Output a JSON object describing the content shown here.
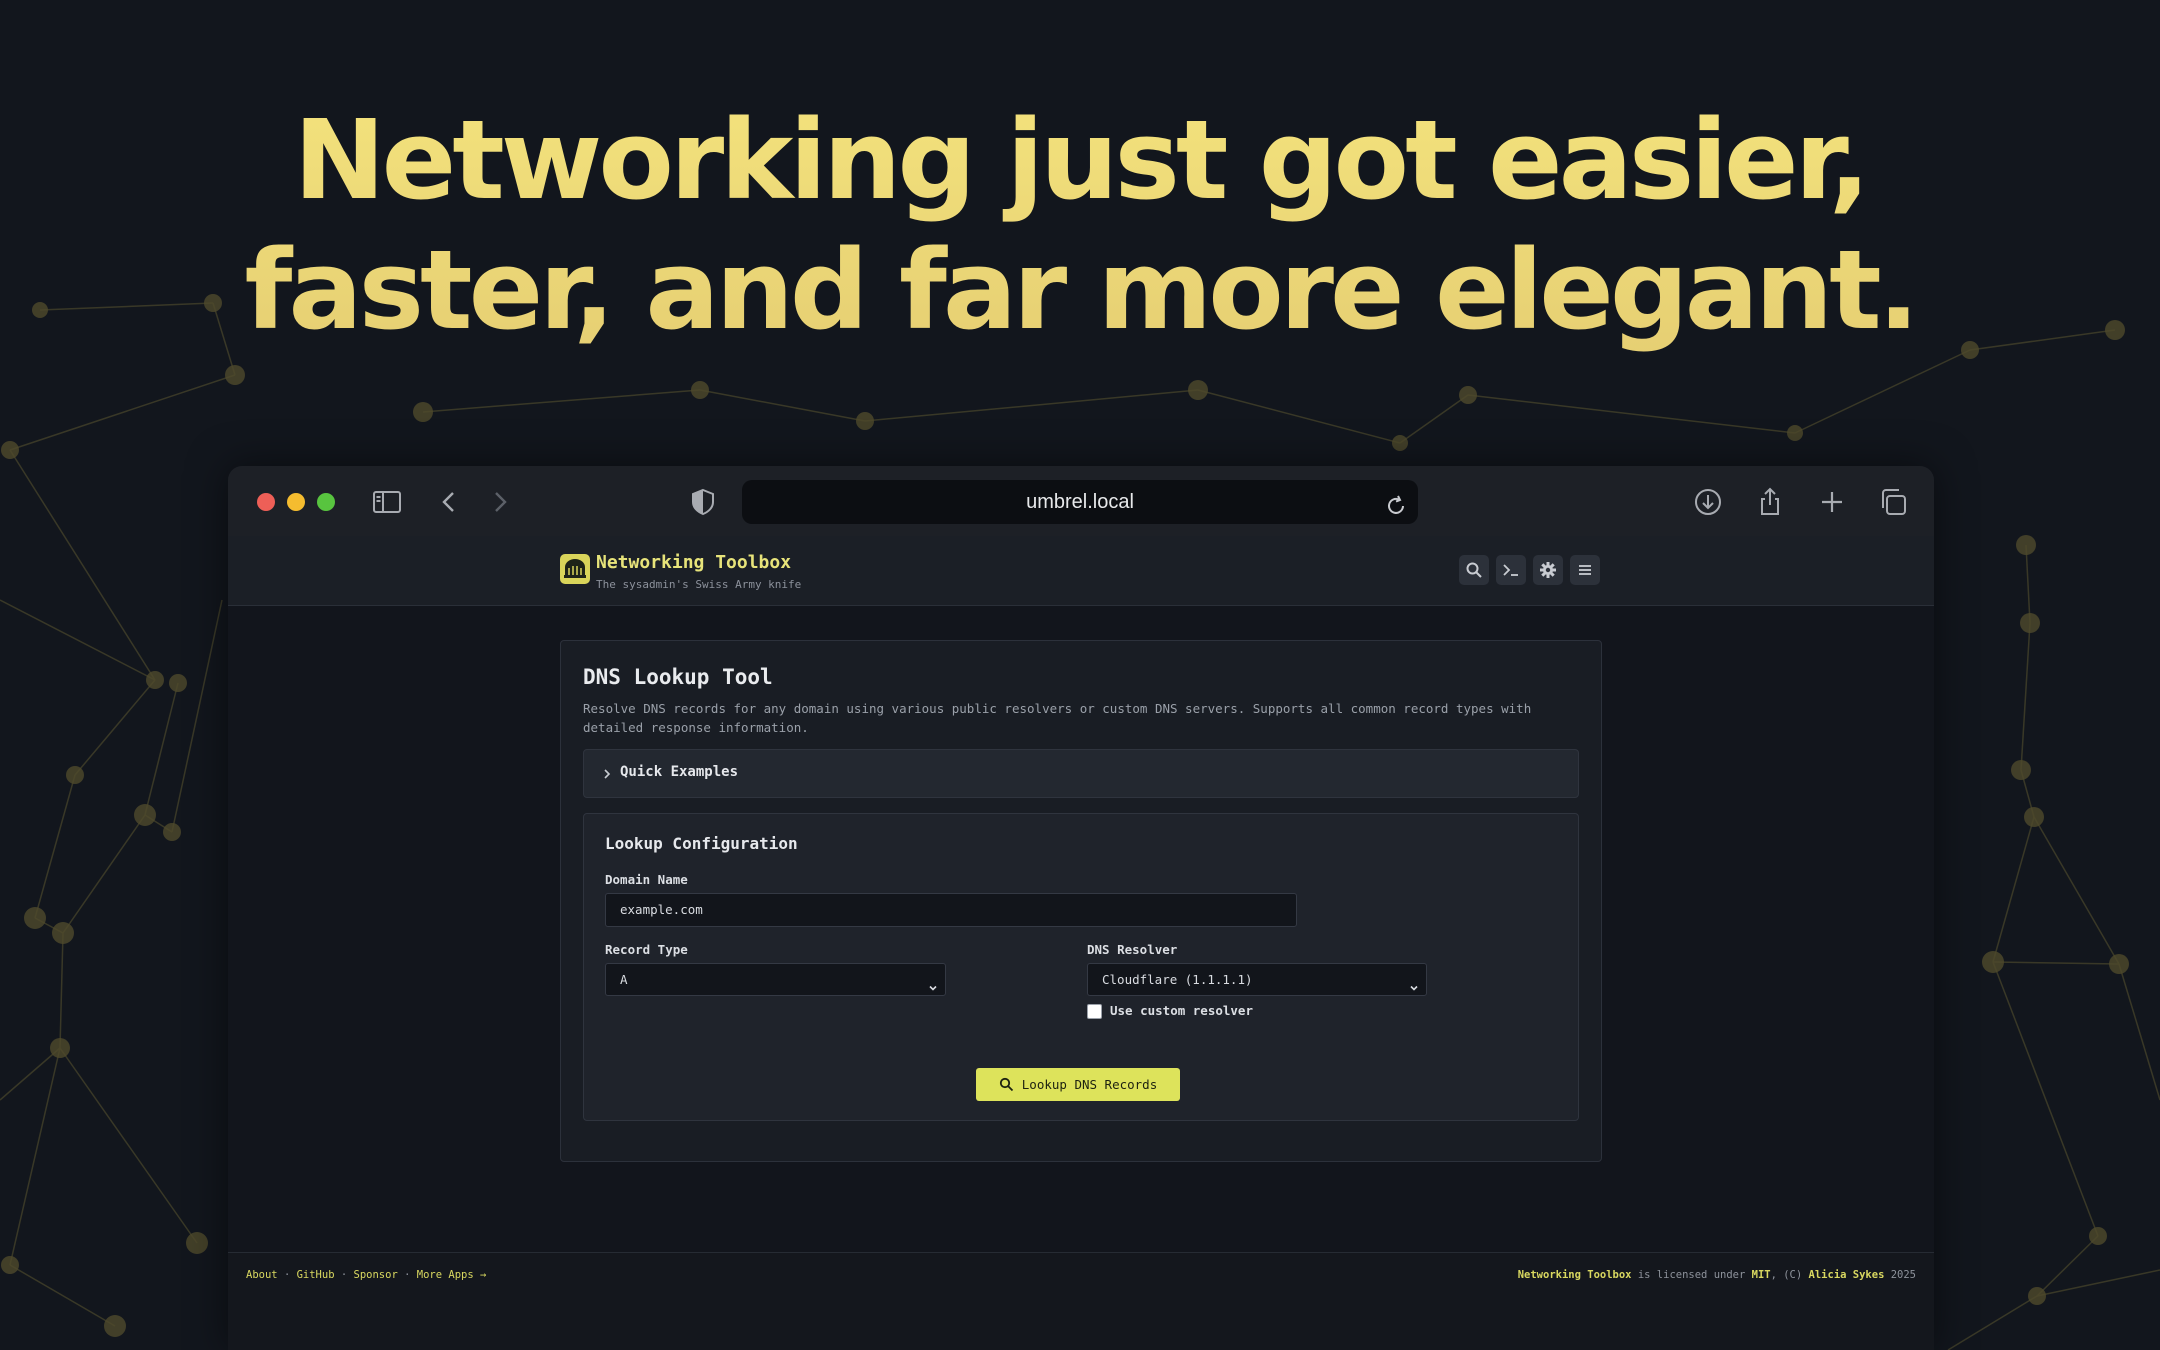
{
  "hero": {
    "line1": "Networking just got easier,",
    "line2": "faster, and far more elegant."
  },
  "browser": {
    "url": "umbrel.local",
    "toolbar_icons": [
      "sidebar-icon",
      "back-icon",
      "forward-icon",
      "shield-icon",
      "reload-icon",
      "download-icon",
      "share-icon",
      "plus-icon",
      "tabs-icon"
    ]
  },
  "app": {
    "title": "Networking Toolbox",
    "subtitle": "The sysadmin's Swiss Army knife",
    "header_icons": [
      "search-icon",
      "terminal-icon",
      "gear-icon",
      "menu-icon"
    ]
  },
  "tool": {
    "title": "DNS Lookup Tool",
    "description": "Resolve DNS records for any domain using various public resolvers or custom DNS servers. Supports all common record types with detailed response information.",
    "examples_label": "Quick Examples",
    "config_title": "Lookup Configuration",
    "domain_label": "Domain Name",
    "domain_value": "example.com",
    "record_type_label": "Record Type",
    "record_type_value": "A",
    "resolver_label": "DNS Resolver",
    "resolver_value": "Cloudflare (1.1.1.1)",
    "custom_resolver_label": "Use custom resolver",
    "custom_resolver_checked": false,
    "submit_label": "Lookup DNS Records"
  },
  "footer": {
    "links": [
      "About",
      "GitHub",
      "Sponsor",
      "More Apps →"
    ],
    "separator": "·",
    "license_project": "Networking Toolbox",
    "license_text_1": " is licensed under ",
    "license_name": "MIT",
    "license_text_2": ", (C) ",
    "author": "Alicia Sykes",
    "year": " 2025"
  },
  "colors": {
    "accent": "#dde35b",
    "headline": "#ecd97a",
    "background": "#12161d"
  }
}
